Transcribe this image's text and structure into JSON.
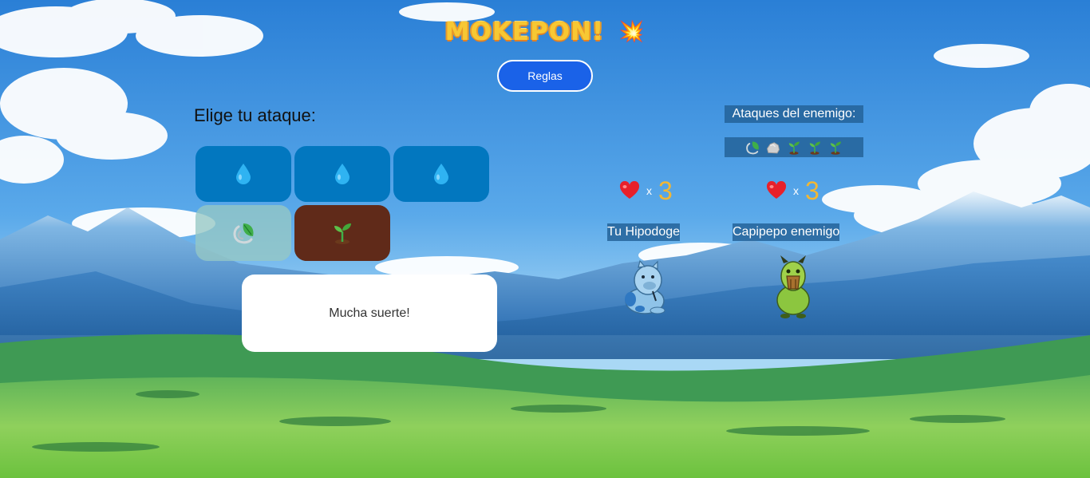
{
  "game": {
    "title": "MOKEPON!",
    "title_emoji": "💥",
    "rules_button": "Reglas"
  },
  "attack_panel": {
    "heading": "Elige tu ataque:",
    "attacks": [
      {
        "type": "water",
        "icon": "water-drop-icon"
      },
      {
        "type": "water",
        "icon": "water-drop-icon"
      },
      {
        "type": "water",
        "icon": "water-drop-icon"
      },
      {
        "type": "wind",
        "icon": "leaf-wind-icon"
      },
      {
        "type": "earth",
        "icon": "sprout-icon"
      }
    ]
  },
  "message": "Mucha suerte!",
  "enemy_attacks": {
    "title": "Ataques del enemigo:",
    "icons": [
      "leaf-wind-icon",
      "rock-icon",
      "sprout-icon",
      "sprout-icon",
      "sprout-icon"
    ]
  },
  "player": {
    "lives_multiplier": "x",
    "lives": "3",
    "pet_label": "Tu Hipodoge"
  },
  "enemy": {
    "lives_multiplier": "x",
    "lives": "3",
    "pet_label": "Capipepo enemigo"
  },
  "colors": {
    "water_button": "#0277bf",
    "wind_button": "#96c8c4",
    "earth_button": "#602a19",
    "rules_button": "#1a62e8",
    "lives_number": "#f2b733",
    "title": "#f7c833"
  }
}
